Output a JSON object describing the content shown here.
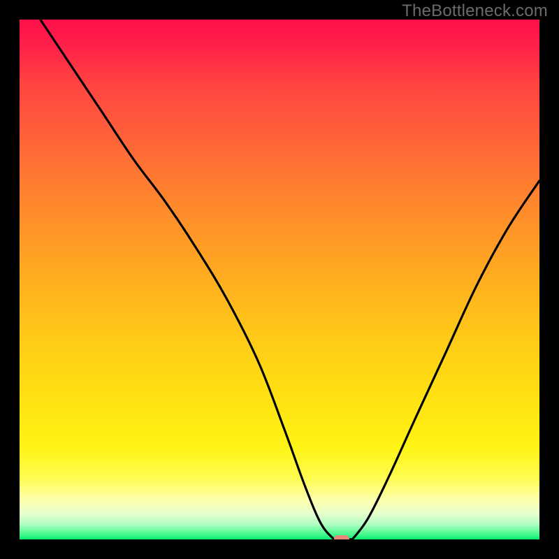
{
  "watermark": "TheBottleneck.com",
  "chart_data": {
    "type": "line",
    "title": "",
    "xlabel": "",
    "ylabel": "",
    "xlim": [
      0,
      100
    ],
    "ylim": [
      0,
      100
    ],
    "grid": false,
    "legend": false,
    "series": [
      {
        "name": "left-branch",
        "x": [
          4,
          10,
          16,
          22,
          28,
          34,
          40,
          46,
          51,
          55,
          58,
          60.5
        ],
        "y": [
          100,
          91,
          82,
          73,
          65,
          56,
          46,
          34,
          21,
          10,
          3,
          0
        ]
      },
      {
        "name": "floor",
        "x": [
          60.5,
          64
        ],
        "y": [
          0,
          0
        ]
      },
      {
        "name": "right-branch",
        "x": [
          64,
          67,
          71,
          76,
          82,
          88,
          94,
          100
        ],
        "y": [
          0,
          4,
          12,
          23,
          36,
          49,
          60,
          69
        ]
      }
    ],
    "marker": {
      "x": 62,
      "y": 0,
      "width": 3,
      "color": "#e7887b"
    },
    "gradient_colors": {
      "top": "#ff0f4a",
      "mid_upper": "#ff9926",
      "mid": "#ffe012",
      "mid_lower": "#fcffb0",
      "bottom": "#00e86f"
    }
  }
}
